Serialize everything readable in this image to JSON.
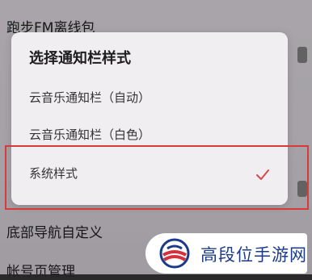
{
  "background_list": {
    "top_item": "跑步FM离线包",
    "nav_item": "底部导航自定义",
    "account_item": "帐号页管理"
  },
  "dialog": {
    "title": "选择通知栏样式",
    "options": [
      {
        "label": "云音乐通知栏（自动）",
        "selected": false
      },
      {
        "label": "云音乐通知栏（白色）",
        "selected": false
      },
      {
        "label": "系统样式",
        "selected": true
      }
    ]
  },
  "watermark": {
    "text": "高段位手游网"
  },
  "colors": {
    "check": "#d6484f",
    "highlight_border": "#d63a3a",
    "watermark_text": "#1a3a8a"
  }
}
